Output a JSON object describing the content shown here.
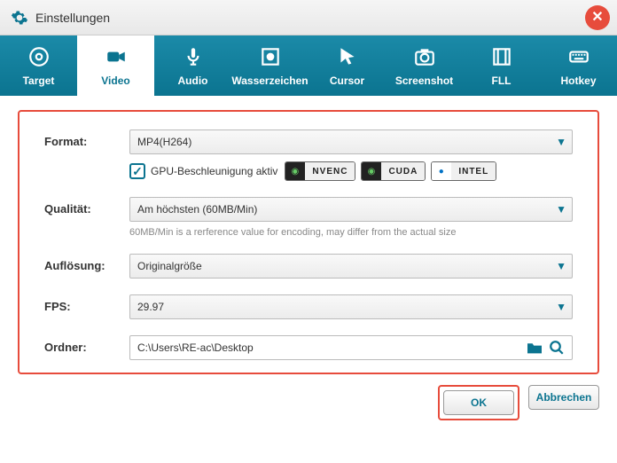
{
  "window": {
    "title": "Einstellungen"
  },
  "tabs": [
    {
      "label": "Target"
    },
    {
      "label": "Video"
    },
    {
      "label": "Audio"
    },
    {
      "label": "Wasserzeichen"
    },
    {
      "label": "Cursor"
    },
    {
      "label": "Screenshot"
    },
    {
      "label": "FLL"
    },
    {
      "label": "Hotkey"
    }
  ],
  "form": {
    "format": {
      "label": "Format:",
      "value": "MP4(H264)"
    },
    "gpu": {
      "checkbox_label": "GPU-Beschleunigung aktiv",
      "badges": [
        "NVENC",
        "CUDA",
        "INTEL"
      ]
    },
    "quality": {
      "label": "Qualität:",
      "value": "Am höchsten (60MB/Min)",
      "hint": "60MB/Min is a rerference value for encoding, may differ from the actual size"
    },
    "resolution": {
      "label": "Auflösung:",
      "value": "Originalgröße"
    },
    "fps": {
      "label": "FPS:",
      "value": "29.97"
    },
    "folder": {
      "label": "Ordner:",
      "value": "C:\\Users\\RE-ac\\Desktop"
    }
  },
  "buttons": {
    "ok": "OK",
    "cancel": "Abbrechen"
  }
}
